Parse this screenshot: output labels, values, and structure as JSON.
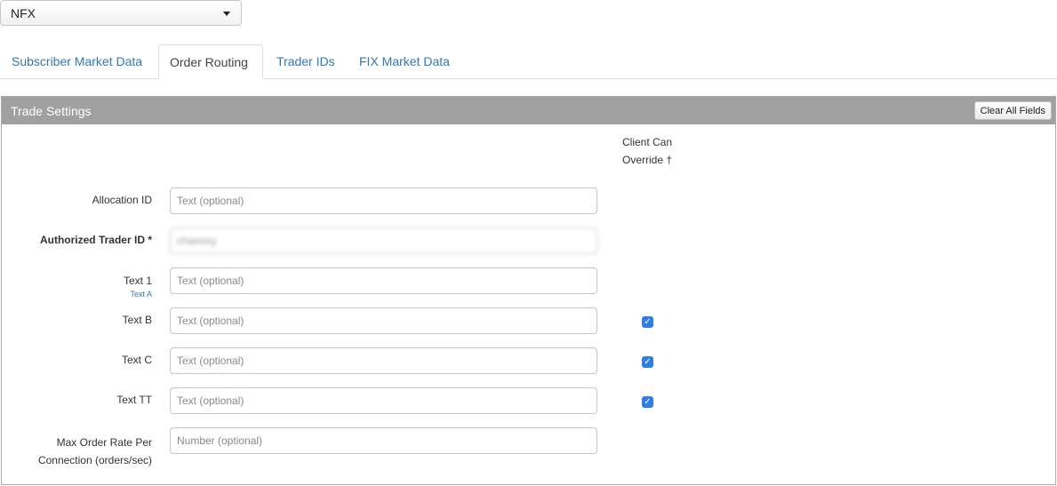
{
  "market_select": {
    "value": "NFX"
  },
  "tabs": [
    {
      "label": "Subscriber Market Data",
      "active": false
    },
    {
      "label": "Order Routing",
      "active": true
    },
    {
      "label": "Trader IDs",
      "active": false
    },
    {
      "label": "FIX Market Data",
      "active": false
    }
  ],
  "panel": {
    "title": "Trade Settings",
    "clear_label": "Clear All Fields",
    "override_header_line1": "Client Can",
    "override_header_line2": "Override †",
    "rows": [
      {
        "label": "Allocation ID",
        "placeholder": "Text (optional)",
        "value": ""
      },
      {
        "label": "Authorized Trader ID *",
        "placeholder": "",
        "value": "chanvey"
      },
      {
        "label": "Text 1",
        "sublabel": "Text A",
        "placeholder": "Text (optional)",
        "value": ""
      },
      {
        "label": "Text B",
        "placeholder": "Text (optional)",
        "value": "",
        "override": true
      },
      {
        "label": "Text C",
        "placeholder": "Text (optional)",
        "value": "",
        "override": true
      },
      {
        "label": "Text TT",
        "placeholder": "Text (optional)",
        "value": "",
        "override": true
      },
      {
        "label_line1": "Max Order Rate Per",
        "label_line2": "Connection (orders/sec)",
        "placeholder": "Number (optional)",
        "value": ""
      }
    ]
  },
  "colors": {
    "link": "#3477b2",
    "header_bg": "#a0a0a0",
    "checkbox": "#2f7ee6"
  },
  "icons": {
    "select_caret": "chevron-down-icon",
    "checkbox_mark": "check-icon"
  }
}
